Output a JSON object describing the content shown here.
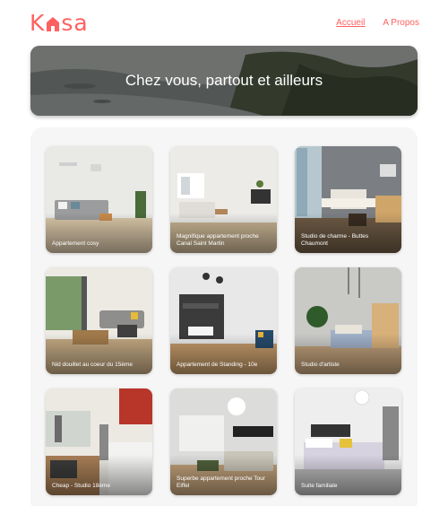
{
  "header": {
    "logo_left": "K",
    "logo_right": "sa",
    "nav": [
      {
        "label": "Accueil",
        "active": true
      },
      {
        "label": "A Propos",
        "active": false
      }
    ]
  },
  "banner": {
    "title": "Chez vous, partout et ailleurs"
  },
  "gallery": {
    "cards": [
      {
        "title": "Appartement cosy"
      },
      {
        "title": "Magnifique appartement proche Canal Saint Martin"
      },
      {
        "title": "Studio de charme - Buttes Chaumont"
      },
      {
        "title": "Nid douillet au coeur du 15ème"
      },
      {
        "title": "Appartement de Standing - 10e"
      },
      {
        "title": "Studio d'artiste"
      },
      {
        "title": "Cheap - Studio 18ème"
      },
      {
        "title": "Superbe appartement proche Tour Eiffel"
      },
      {
        "title": "Suite familiale"
      }
    ]
  },
  "colors": {
    "brand": "#ff6060",
    "gallery_bg": "#f6f6f6"
  }
}
